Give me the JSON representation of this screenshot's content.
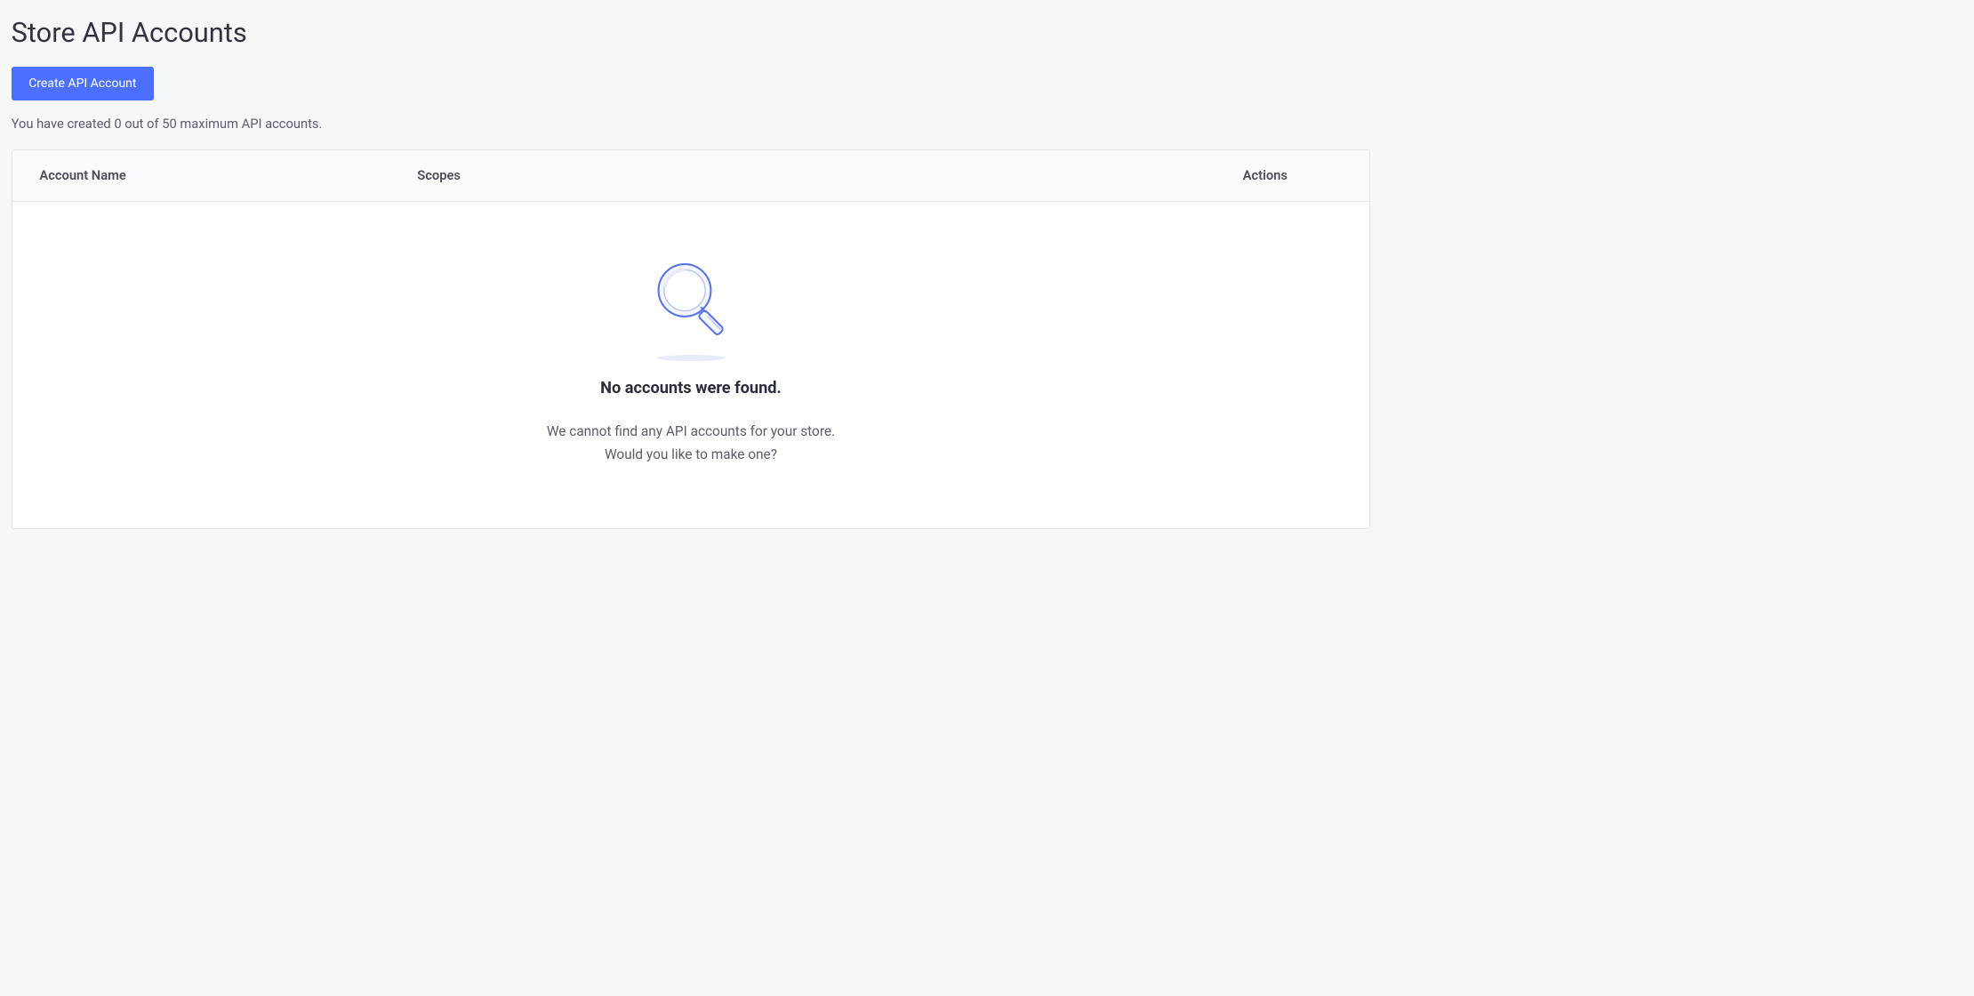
{
  "page": {
    "title": "Store API Accounts"
  },
  "create_button": {
    "label": "Create API Account"
  },
  "info": {
    "text": "You have created 0 out of 50 maximum API accounts."
  },
  "table": {
    "columns": {
      "name": "Account Name",
      "scopes": "Scopes",
      "actions": "Actions"
    }
  },
  "empty_state": {
    "title": "No accounts were found.",
    "line1": "We cannot find any API accounts for your store.",
    "line2": "Would you like to make one?"
  }
}
